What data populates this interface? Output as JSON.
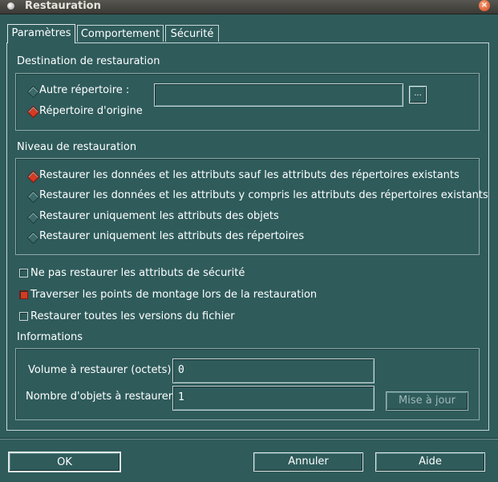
{
  "window": {
    "title": "Restauration"
  },
  "tabs": [
    {
      "label": "Paramètres",
      "active": true
    },
    {
      "label": "Comportement",
      "active": false
    },
    {
      "label": "Sécurité",
      "active": false
    }
  ],
  "destination": {
    "label": "Destination de restauration",
    "options": [
      {
        "label": "Autre répertoire :",
        "selected": false
      },
      {
        "label": "Répertoire d'origine",
        "selected": true
      }
    ],
    "path_value": "",
    "browse_label": "..."
  },
  "niveau": {
    "label": "Niveau de restauration",
    "options": [
      {
        "label": "Restaurer les données et les attributs sauf les attributs des répertoires existants",
        "selected": true
      },
      {
        "label": "Restaurer les données et les attributs y compris les attributs des répertoires existants",
        "selected": false
      },
      {
        "label": "Restaurer uniquement les attributs des objets",
        "selected": false
      },
      {
        "label": "Restaurer uniquement les attributs des répertoires",
        "selected": false
      }
    ]
  },
  "checks": [
    {
      "label": "Ne pas restaurer les attributs de sécurité",
      "checked": false
    },
    {
      "label": "Traverser les points de montage lors de la restauration",
      "checked": true
    },
    {
      "label": "Restaurer toutes les versions du fichier",
      "checked": false
    }
  ],
  "informations": {
    "label": "Informations",
    "volume_label": "Volume à restaurer (octets) :",
    "volume_value": "0",
    "objets_label": "Nombre d'objets à restaurer :",
    "objets_value": "1",
    "update_label": "Mise à jour"
  },
  "footer": {
    "ok_label": "OK",
    "cancel_label": "Annuler",
    "help_label": "Aide"
  },
  "colors": {
    "background": "#2f5b5b",
    "selected_indicator": "#d63a22"
  }
}
